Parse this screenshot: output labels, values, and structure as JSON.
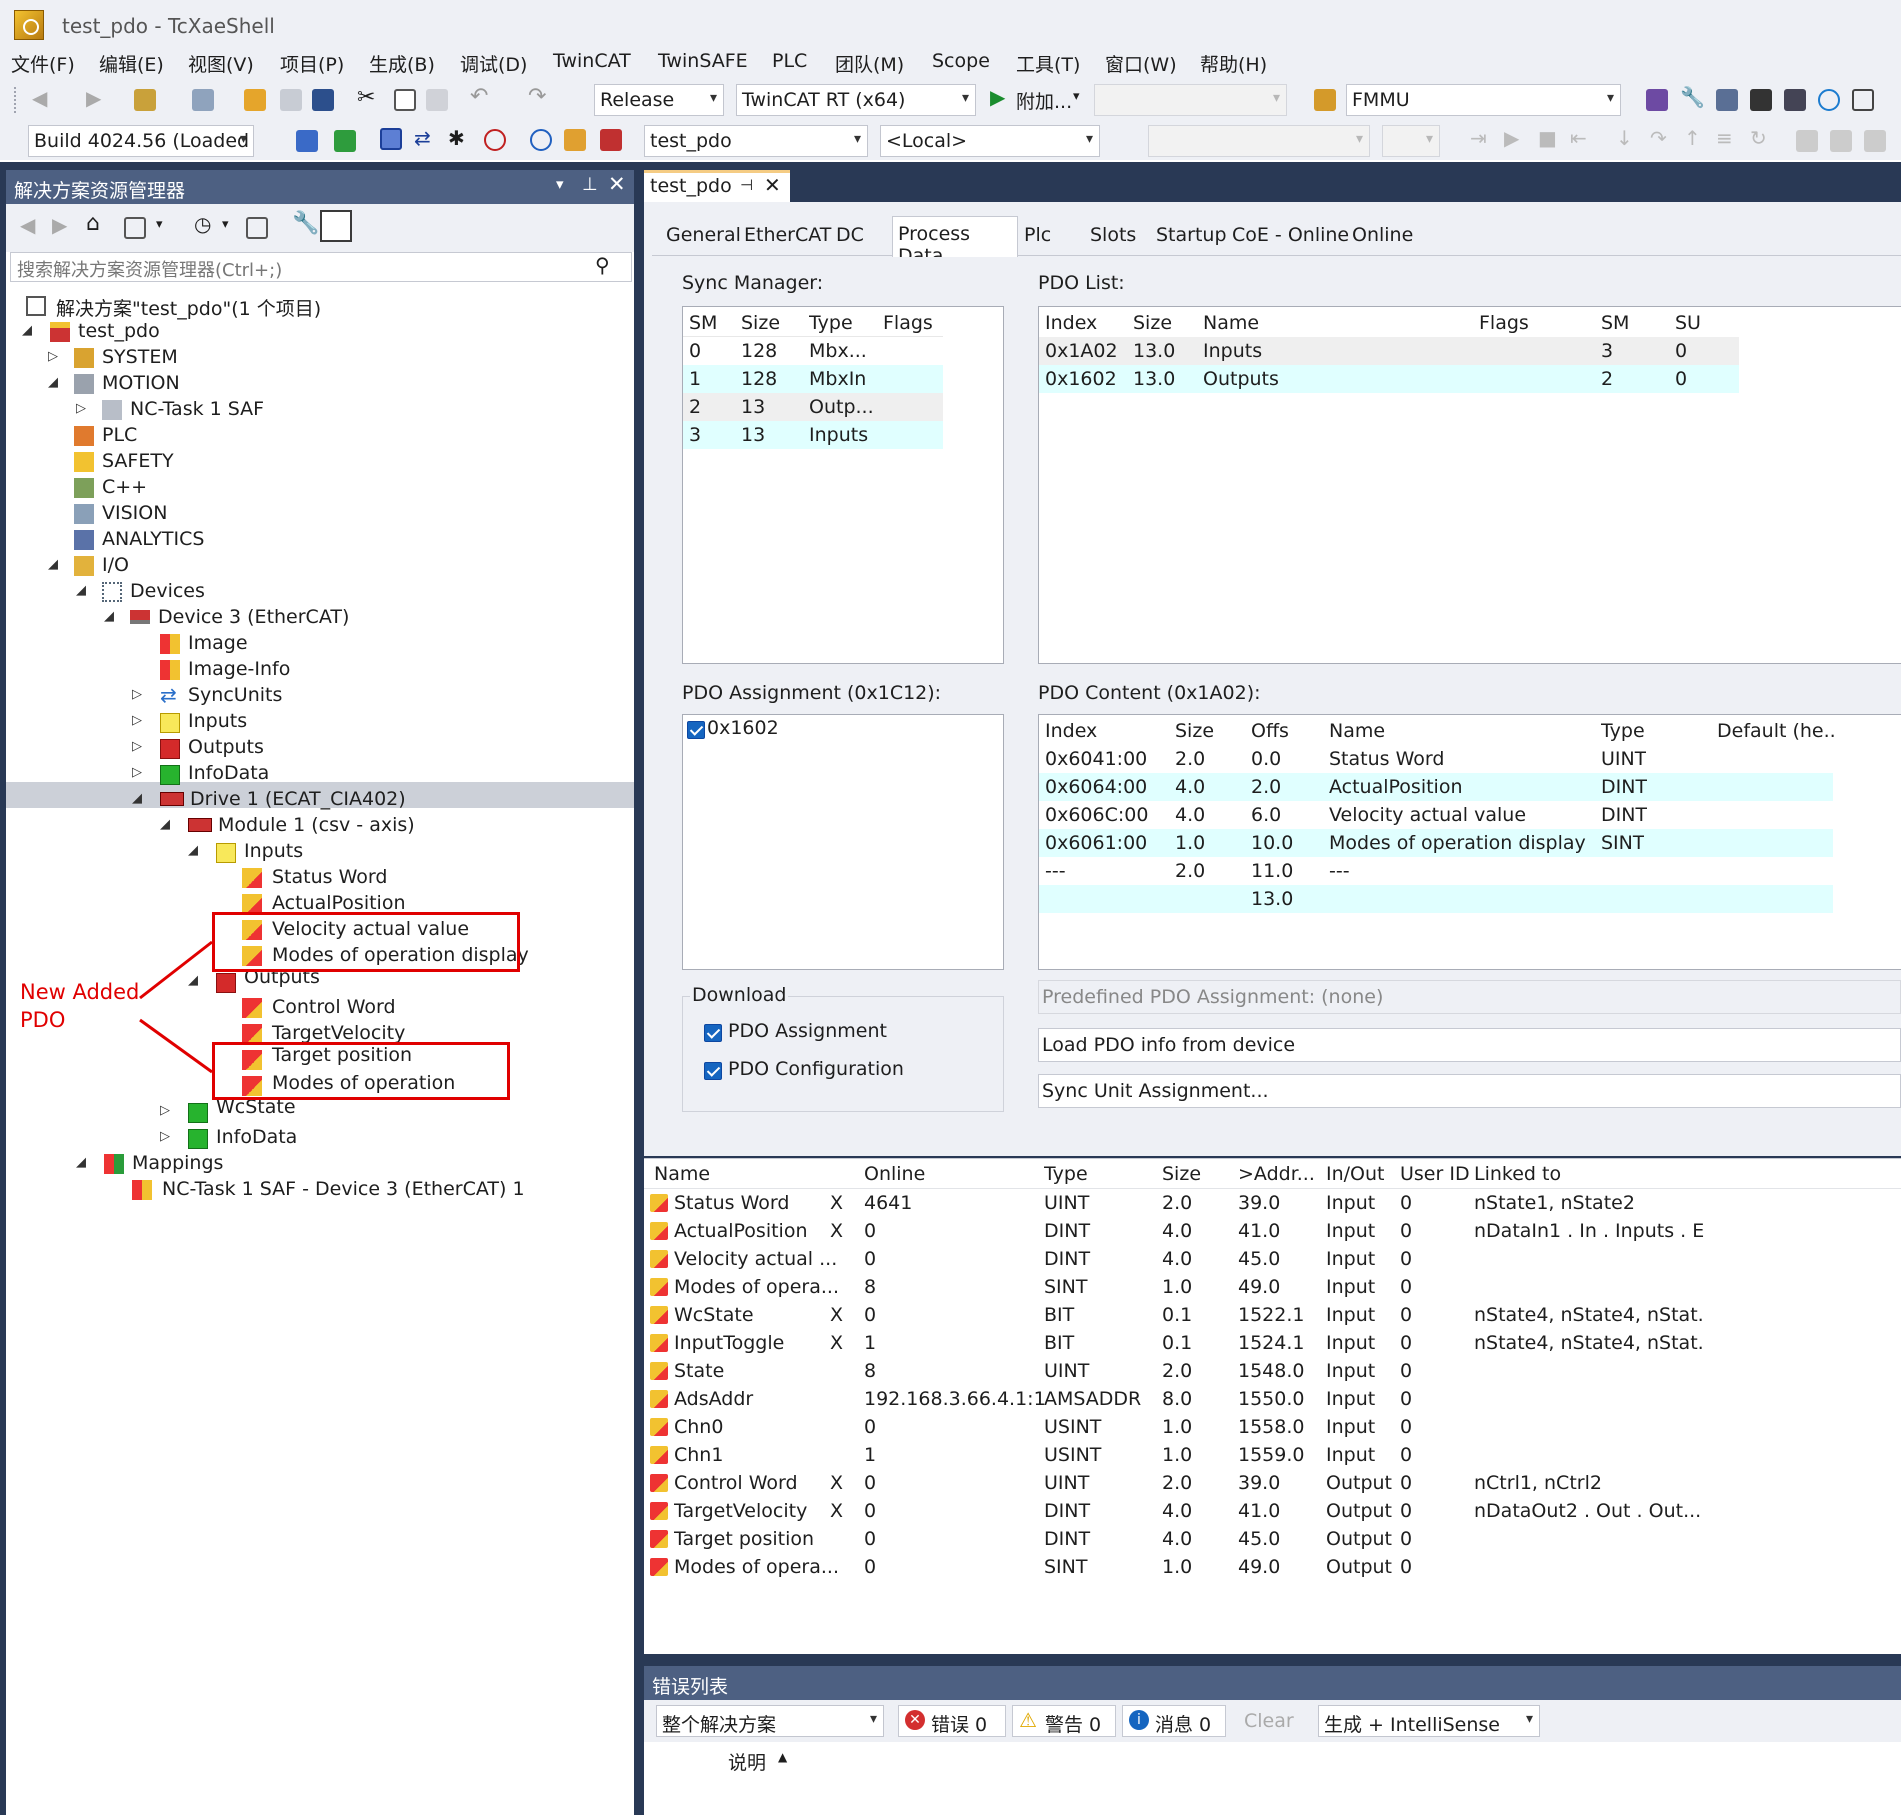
{
  "window": {
    "title": "test_pdo - TcXaeShell"
  },
  "menu": [
    "文件(F)",
    "编辑(E)",
    "视图(V)",
    "项目(P)",
    "生成(B)",
    "调试(D)",
    "TwinCAT",
    "TwinSAFE",
    "PLC",
    "团队(M)",
    "Scope",
    "工具(T)",
    "窗口(W)",
    "帮助(H)"
  ],
  "toolbar1": {
    "config": "Release",
    "platform": "TwinCAT RT (x64)",
    "attach": "附加...",
    "fmmu": "FMMU"
  },
  "toolbar2": {
    "build": "Build 4024.56 (Loaded",
    "project": "test_pdo",
    "target": "<Local>"
  },
  "solution_explorer": {
    "title": "解决方案资源管理器",
    "search_placeholder": "搜索解决方案资源管理器(Ctrl+;)",
    "tree": [
      {
        "label": "解决方案\"test_pdo\"(1 个项目)",
        "icon": "solution-icon"
      },
      {
        "label": "test_pdo",
        "icon": "project-icon"
      },
      {
        "label": "SYSTEM",
        "icon": "system-icon"
      },
      {
        "label": "MOTION",
        "icon": "motion-icon"
      },
      {
        "label": "NC-Task 1 SAF",
        "icon": "nc-task-icon"
      },
      {
        "label": "PLC",
        "icon": "plc-icon"
      },
      {
        "label": "SAFETY",
        "icon": "safety-icon"
      },
      {
        "label": "C++",
        "icon": "cpp-icon"
      },
      {
        "label": "VISION",
        "icon": "vision-icon"
      },
      {
        "label": "ANALYTICS",
        "icon": "analytics-icon"
      },
      {
        "label": "I/O",
        "icon": "io-icon"
      },
      {
        "label": "Devices",
        "icon": "devices-icon"
      },
      {
        "label": "Device 3 (EtherCAT)",
        "icon": "ethercat-device-icon"
      },
      {
        "label": "Image",
        "icon": "image-icon"
      },
      {
        "label": "Image-Info",
        "icon": "image-info-icon"
      },
      {
        "label": "SyncUnits",
        "icon": "syncunits-icon"
      },
      {
        "label": "Inputs",
        "icon": "inputs-folder-icon"
      },
      {
        "label": "Outputs",
        "icon": "outputs-folder-icon"
      },
      {
        "label": "InfoData",
        "icon": "infodata-icon"
      },
      {
        "label": "Drive 1 (ECAT_CIA402)",
        "icon": "drive-icon"
      },
      {
        "label": "Module 1 (csv -  axis)",
        "icon": "module-icon"
      },
      {
        "label": "Inputs",
        "icon": "inputs-folder-icon"
      },
      {
        "label": "Status Word",
        "icon": "input-var-icon"
      },
      {
        "label": "ActualPosition",
        "icon": "input-var-icon"
      },
      {
        "label": "Velocity actual value",
        "icon": "input-var-icon"
      },
      {
        "label": "Modes of operation display",
        "icon": "input-var-icon"
      },
      {
        "label": "Outputs",
        "icon": "outputs-folder-icon"
      },
      {
        "label": "Control Word",
        "icon": "output-var-icon"
      },
      {
        "label": "TargetVelocity",
        "icon": "output-var-icon"
      },
      {
        "label": "Target position",
        "icon": "output-var-icon"
      },
      {
        "label": "Modes of operation",
        "icon": "output-var-icon"
      },
      {
        "label": "WcState",
        "icon": "wcstate-icon"
      },
      {
        "label": "InfoData",
        "icon": "infodata-icon"
      },
      {
        "label": "Mappings",
        "icon": "mappings-icon"
      },
      {
        "label": "NC-Task 1 SAF - Device 3 (EtherCAT) 1",
        "icon": "mapping-item-icon"
      }
    ]
  },
  "annotation": {
    "line1": "New Added",
    "line2": "PDO"
  },
  "editor": {
    "tab": "test_pdo",
    "subtabs": [
      "General",
      "EtherCAT",
      "DC",
      "Process Data",
      "Plc",
      "Slots",
      "Startup",
      "CoE - Online",
      "Online"
    ],
    "active_subtab": "Process Data",
    "sync_manager": {
      "label": "Sync Manager:",
      "columns": [
        "SM",
        "Size",
        "Type",
        "Flags"
      ],
      "rows": [
        [
          "0",
          "128",
          "Mbx...",
          ""
        ],
        [
          "1",
          "128",
          "MbxIn",
          ""
        ],
        [
          "2",
          "13",
          "Outp...",
          ""
        ],
        [
          "3",
          "13",
          "Inputs",
          ""
        ]
      ]
    },
    "pdo_list": {
      "label": "PDO List:",
      "columns": [
        "Index",
        "Size",
        "Name",
        "Flags",
        "SM",
        "SU"
      ],
      "rows": [
        [
          "0x1A02",
          "13.0",
          "Inputs",
          "",
          "3",
          "0"
        ],
        [
          "0x1602",
          "13.0",
          "Outputs",
          "",
          "2",
          "0"
        ]
      ]
    },
    "pdo_assignment": {
      "label": "PDO Assignment (0x1C12):",
      "items": [
        "0x1602"
      ]
    },
    "pdo_content": {
      "label": "PDO Content (0x1A02):",
      "columns": [
        "Index",
        "Size",
        "Offs",
        "Name",
        "Type",
        "Default (he..."
      ],
      "rows": [
        [
          "0x6041:00",
          "2.0",
          "0.0",
          "Status Word",
          "UINT",
          ""
        ],
        [
          "0x6064:00",
          "4.0",
          "2.0",
          "ActualPosition",
          "DINT",
          ""
        ],
        [
          "0x606C:00",
          "4.0",
          "6.0",
          "Velocity actual value",
          "DINT",
          ""
        ],
        [
          "0x6061:00",
          "1.0",
          "10.0",
          "Modes of operation display",
          "SINT",
          ""
        ],
        [
          "---",
          "2.0",
          "11.0",
          "---",
          "",
          ""
        ],
        [
          "",
          "",
          "13.0",
          "",
          "",
          ""
        ]
      ]
    },
    "download": {
      "label": "Download",
      "pdo_assignment": "PDO Assignment",
      "pdo_configuration": "PDO Configuration"
    },
    "predefined": "Predefined PDO Assignment: (none)",
    "load_pdo": "Load PDO info from device",
    "sync_unit": "Sync Unit Assignment..."
  },
  "variables": {
    "columns": [
      "Name",
      "Online",
      "Type",
      "Size",
      ">Addr...",
      "In/Out",
      "User ID",
      "Linked to"
    ],
    "rows": [
      {
        "name": "Status Word",
        "x": "X",
        "online": "4641",
        "type": "UINT",
        "size": "2.0",
        "addr": "39.0",
        "inout": "Input",
        "uid": "0",
        "linked": "nState1, nState2",
        "kind": "in"
      },
      {
        "name": "ActualPosition",
        "x": "X",
        "online": "0",
        "type": "DINT",
        "size": "4.0",
        "addr": "41.0",
        "inout": "Input",
        "uid": "0",
        "linked": "nDataIn1 . In . Inputs . E...",
        "kind": "in"
      },
      {
        "name": "Velocity actual ...",
        "x": "",
        "online": "0",
        "type": "DINT",
        "size": "4.0",
        "addr": "45.0",
        "inout": "Input",
        "uid": "0",
        "linked": "",
        "kind": "in"
      },
      {
        "name": "Modes of opera...",
        "x": "",
        "online": "8",
        "type": "SINT",
        "size": "1.0",
        "addr": "49.0",
        "inout": "Input",
        "uid": "0",
        "linked": "",
        "kind": "in"
      },
      {
        "name": "WcState",
        "x": "X",
        "online": "0",
        "type": "BIT",
        "size": "0.1",
        "addr": "1522.1",
        "inout": "Input",
        "uid": "0",
        "linked": "nState4, nState4, nStat...",
        "kind": "in"
      },
      {
        "name": "InputToggle",
        "x": "X",
        "online": "1",
        "type": "BIT",
        "size": "0.1",
        "addr": "1524.1",
        "inout": "Input",
        "uid": "0",
        "linked": "nState4, nState4, nStat...",
        "kind": "in"
      },
      {
        "name": "State",
        "x": "",
        "online": "8",
        "type": "UINT",
        "size": "2.0",
        "addr": "1548.0",
        "inout": "Input",
        "uid": "0",
        "linked": "",
        "kind": "in"
      },
      {
        "name": "AdsAddr",
        "x": "",
        "online": "192.168.3.66.4.1:1...",
        "type": "AMSADDR",
        "size": "8.0",
        "addr": "1550.0",
        "inout": "Input",
        "uid": "0",
        "linked": "",
        "kind": "in"
      },
      {
        "name": "Chn0",
        "x": "",
        "online": "0",
        "type": "USINT",
        "size": "1.0",
        "addr": "1558.0",
        "inout": "Input",
        "uid": "0",
        "linked": "",
        "kind": "in"
      },
      {
        "name": "Chn1",
        "x": "",
        "online": "1",
        "type": "USINT",
        "size": "1.0",
        "addr": "1559.0",
        "inout": "Input",
        "uid": "0",
        "linked": "",
        "kind": "in"
      },
      {
        "name": "Control Word",
        "x": "X",
        "online": "0",
        "type": "UINT",
        "size": "2.0",
        "addr": "39.0",
        "inout": "Output",
        "uid": "0",
        "linked": "nCtrl1, nCtrl2",
        "kind": "out"
      },
      {
        "name": "TargetVelocity",
        "x": "X",
        "online": "0",
        "type": "DINT",
        "size": "4.0",
        "addr": "41.0",
        "inout": "Output",
        "uid": "0",
        "linked": "nDataOut2 . Out . Out...",
        "kind": "out"
      },
      {
        "name": "Target position",
        "x": "",
        "online": "0",
        "type": "DINT",
        "size": "4.0",
        "addr": "45.0",
        "inout": "Output",
        "uid": "0",
        "linked": "",
        "kind": "out"
      },
      {
        "name": "Modes of opera...",
        "x": "",
        "online": "0",
        "type": "SINT",
        "size": "1.0",
        "addr": "49.0",
        "inout": "Output",
        "uid": "0",
        "linked": "",
        "kind": "out"
      }
    ]
  },
  "error_list": {
    "title": "错误列表",
    "scope": "整个解决方案",
    "errors": "错误 0",
    "warnings": "警告 0",
    "messages": "消息 0",
    "clear": "Clear",
    "build_filter": "生成 + IntelliSense",
    "col_desc": "说明"
  }
}
